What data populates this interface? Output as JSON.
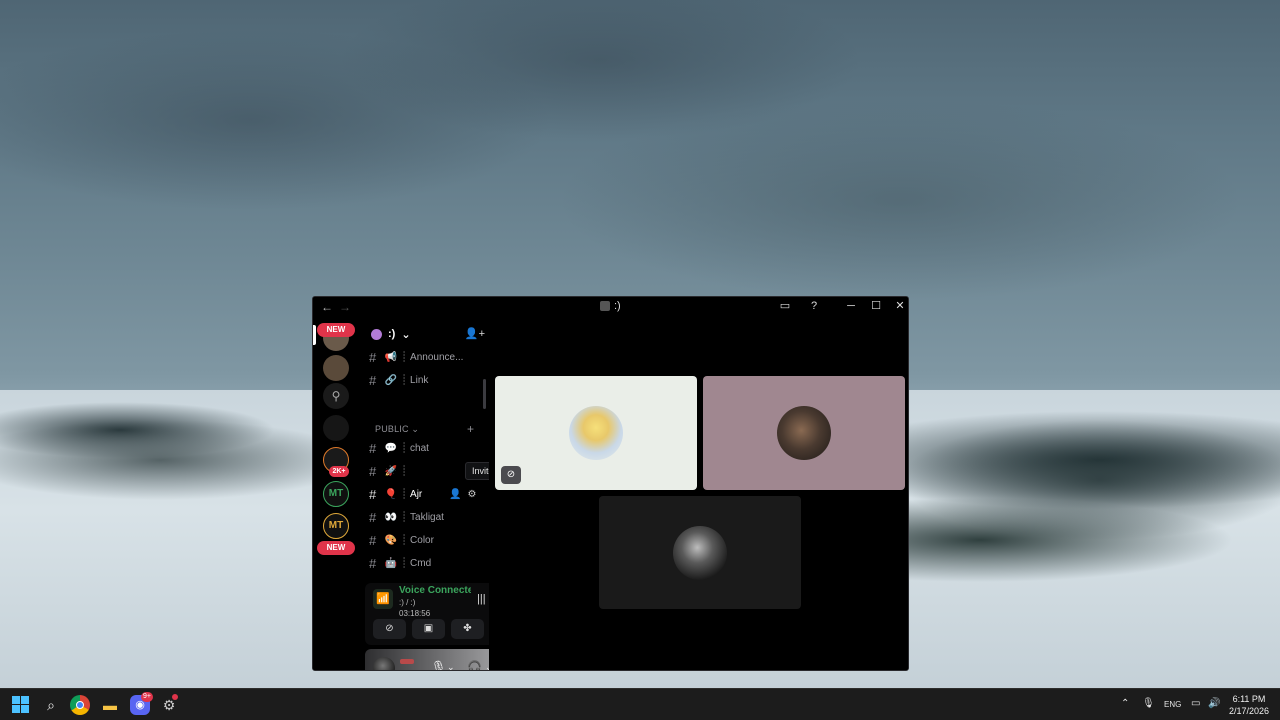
{
  "window": {
    "title": ":)",
    "nav_back": "←",
    "nav_forward": "→",
    "inbox_icon": "inbox-icon",
    "help_icon": "help-icon",
    "minimize": "─",
    "maximize": "☐",
    "close": "✕"
  },
  "rail": {
    "new_badge": "NEW",
    "new_badge_2": "NEW",
    "count_badge": "2K+",
    "mt_label": "MT",
    "mt_label_2": "MT",
    "accent_green": "#3ba55d",
    "accent_gold": "#e0a93a"
  },
  "server": {
    "name": ":)",
    "chevron": "⌄",
    "invite_icon": "add-member-icon"
  },
  "channels": [
    {
      "icon": "📢",
      "name": "Announce..."
    },
    {
      "icon": "🔗",
      "name": "Link"
    }
  ],
  "category": {
    "name": "PUBLIC ⌄",
    "add": "+"
  },
  "public_channels": [
    {
      "icon": "💬",
      "name": "chat"
    },
    {
      "icon": "🚀",
      "name": ""
    },
    {
      "icon": "🎈",
      "name": "Ajr"
    },
    {
      "icon": "👀",
      "name": "Takligat"
    },
    {
      "icon": "🎨",
      "name": "Color"
    },
    {
      "icon": "🤖",
      "name": "Cmd"
    }
  ],
  "tooltip": "Invite to Channel",
  "voice": {
    "status": "Voice Connecte",
    "channel": ":) / :)",
    "elapsed": "03:18:56"
  },
  "stage": {
    "tiles": [
      {
        "bg": "#eaeee8",
        "muted": true
      },
      {
        "bg": "#a08790",
        "muted": false
      },
      {
        "bg": "#1a1a1a",
        "muted": false
      }
    ]
  },
  "taskbar": {
    "lang": "ENG",
    "time": "6:11 PM",
    "date": "2/17/2026",
    "discord_badge": "9+"
  }
}
